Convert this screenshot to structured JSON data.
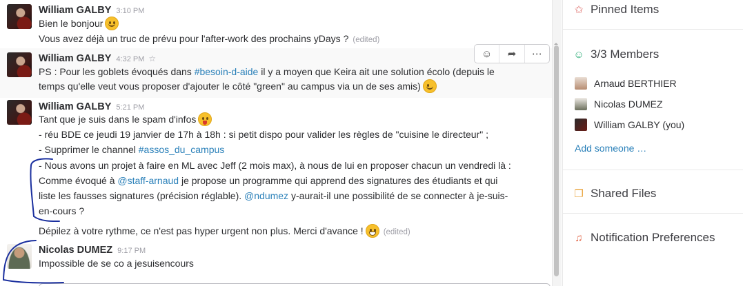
{
  "messages": [
    {
      "author": "William GALBY",
      "time": "3:10 PM",
      "lines": [
        "Bien le bonjour",
        "Vous avez déjà un truc de prévu pour l'after-work des prochains yDays ?"
      ],
      "edited": "(edited)"
    },
    {
      "author": "William GALBY",
      "time": "4:32 PM",
      "line1_pre": "PS : Pour les goblets évoqués dans ",
      "channel": "#besoin-d-aide",
      "line1_post": " il y a moyen que Keira ait une solution écolo (depuis le",
      "line2": "temps qu'elle veut vous proposer d'ajouter le côté \"green\" au campus via un de ses amis)"
    },
    {
      "author": "William GALBY",
      "time": "5:21 PM",
      "line1": "Tant que je suis dans le spam d'infos",
      "line2": "- réu BDE ce jeudi 19 janvier de 17h à 18h : si petit dispo pour valider les règles de \"cuisine le directeur\" ;",
      "line3_pre": "- Supprimer le channel ",
      "channel": "#assos_du_campus",
      "line4": "- Nous avons un projet à faire en ML avec Jeff (2 mois max), à nous de lui en proposer chacun un vendredi là :",
      "line5_pre": "Comme évoqué à ",
      "mention1": "@staff-arnaud",
      "line5_post": " je propose un programme qui apprend des signatures des étudiants et qui",
      "line6_pre": "liste les fausses signatures (précision réglable). ",
      "mention2": "@ndumez",
      "line6_post": " y-aurait-il une possibilité de se connecter à je-suis-",
      "line7": "en-cours ?",
      "line8": "Dépilez à votre rythme, ce n'est pas hyper urgent non plus. Merci d'avance !",
      "edited": "(edited)"
    },
    {
      "author": "Nicolas DUMEZ",
      "time": "9:17 PM",
      "line1": "Impossible de se co a jesuisencours"
    }
  ],
  "panel": {
    "pinned": "Pinned Items",
    "members_count": "3/3",
    "members_label": "Members",
    "members": [
      "Arnaud BERTHIER",
      "Nicolas DUMEZ",
      "William GALBY (you)"
    ],
    "add_someone": "Add someone …",
    "shared_files": "Shared Files",
    "notification_prefs": "Notification Preferences"
  },
  "colors": {
    "link": "#2a80b9",
    "members_icon": "#2bac76",
    "pinned_icon": "#d9534f",
    "files_icon": "#e8a23a",
    "bell_icon": "#e05a3a",
    "annotation_ink": "#1a2f9e"
  },
  "icons": [
    "add-reaction-icon",
    "share-icon",
    "more-icon",
    "pin-icon",
    "member-icon",
    "files-icon",
    "bell-icon",
    "star-icon"
  ]
}
